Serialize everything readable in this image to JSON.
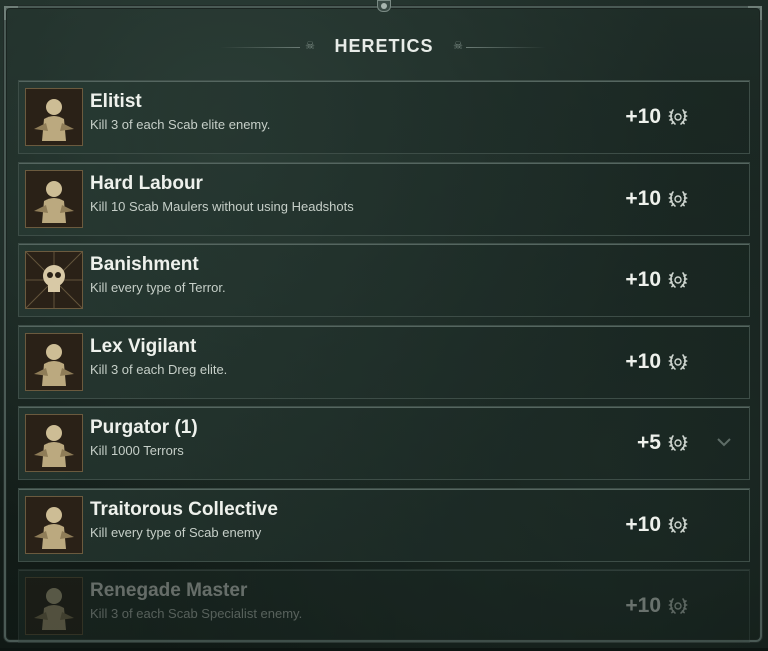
{
  "header": {
    "title": "HERETICS"
  },
  "achievements": [
    {
      "name": "Elitist",
      "description": "Kill 3 of each Scab elite enemy.",
      "reward": "+10",
      "icon": "scab-elite-icon",
      "faded": false,
      "expand": false
    },
    {
      "name": "Hard Labour",
      "description": "Kill 10 Scab Maulers without using Headshots",
      "reward": "+10",
      "icon": "scab-mauler-icon",
      "faded": false,
      "expand": false
    },
    {
      "name": "Banishment",
      "description": "Kill every type of Terror.",
      "reward": "+10",
      "icon": "skull-icon",
      "faded": false,
      "expand": false
    },
    {
      "name": "Lex Vigilant",
      "description": "Kill 3 of each Dreg elite.",
      "reward": "+10",
      "icon": "dreg-elite-icon",
      "faded": false,
      "expand": false
    },
    {
      "name": "Purgator (1)",
      "description": "Kill 1000 Terrors",
      "reward": "+5",
      "icon": "horde-icon",
      "faded": false,
      "expand": true
    },
    {
      "name": "Traitorous Collective",
      "description": "Kill every type of Scab enemy",
      "reward": "+10",
      "icon": "scab-squad-icon",
      "faded": false,
      "expand": false
    },
    {
      "name": "Renegade Master",
      "description": "Kill 3 of each Scab Specialist enemy.",
      "reward": "+10",
      "icon": "scab-specialist-icon",
      "faded": true,
      "expand": false
    }
  ]
}
